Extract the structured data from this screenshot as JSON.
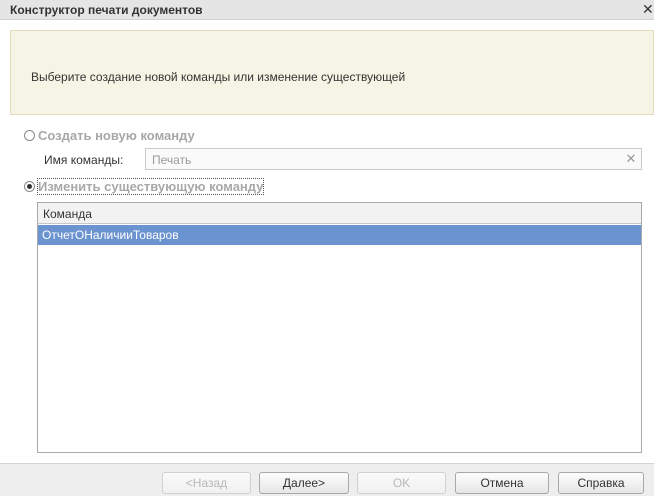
{
  "window": {
    "title": "Конструктор печати документов",
    "close_glyph": "✕"
  },
  "info": {
    "text": "Выберите создание новой команды или изменение существующей"
  },
  "options": {
    "create_new_label": "Создать новую команду",
    "create_new_selected": false,
    "change_existing_label": "Изменить существующую команду",
    "change_existing_selected": true
  },
  "name_field": {
    "label": "Имя команды:",
    "value": "Печать",
    "clear_glyph": "✕"
  },
  "commands_table": {
    "column_header": "Команда",
    "rows": [
      {
        "name": "ОтчетОНаличииТоваров",
        "selected": true
      }
    ]
  },
  "buttons": {
    "back": "<Назад",
    "next": "Далее>",
    "ok": "OK",
    "cancel": "Отмена",
    "help": "Справка"
  },
  "colors": {
    "selection": "#6b93d0",
    "info_panel": "#f6f4e4",
    "disabled_text": "#a8a8a8"
  }
}
